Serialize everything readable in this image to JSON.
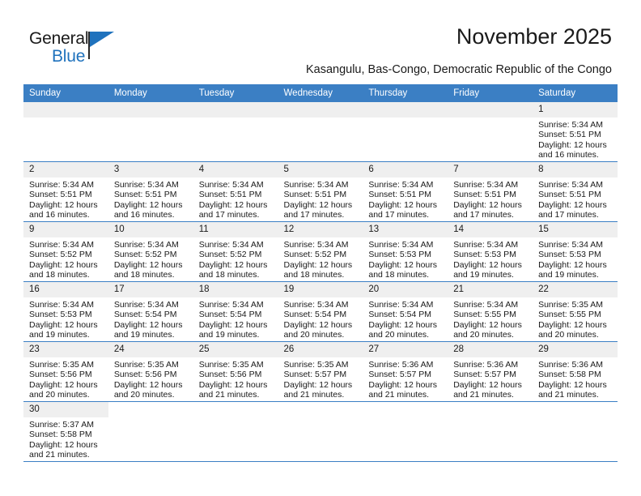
{
  "brand": {
    "name_top": "General",
    "name_bottom": "Blue",
    "flag_icon": "blue-triangle-flag",
    "accent_color": "#1f72bd"
  },
  "header": {
    "title": "November 2025",
    "subtitle": "Kasangulu, Bas-Congo, Democratic Republic of the Congo"
  },
  "calendar": {
    "header_bg": "#3b7fc4",
    "daynum_bg": "#efefef",
    "weekday_headers": [
      "Sunday",
      "Monday",
      "Tuesday",
      "Wednesday",
      "Thursday",
      "Friday",
      "Saturday"
    ],
    "weeks": [
      [
        {
          "day": "",
          "lines": []
        },
        {
          "day": "",
          "lines": []
        },
        {
          "day": "",
          "lines": []
        },
        {
          "day": "",
          "lines": []
        },
        {
          "day": "",
          "lines": []
        },
        {
          "day": "",
          "lines": []
        },
        {
          "day": "1",
          "lines": [
            "Sunrise: 5:34 AM",
            "Sunset: 5:51 PM",
            "Daylight: 12 hours",
            "and 16 minutes."
          ]
        }
      ],
      [
        {
          "day": "2",
          "lines": [
            "Sunrise: 5:34 AM",
            "Sunset: 5:51 PM",
            "Daylight: 12 hours",
            "and 16 minutes."
          ]
        },
        {
          "day": "3",
          "lines": [
            "Sunrise: 5:34 AM",
            "Sunset: 5:51 PM",
            "Daylight: 12 hours",
            "and 16 minutes."
          ]
        },
        {
          "day": "4",
          "lines": [
            "Sunrise: 5:34 AM",
            "Sunset: 5:51 PM",
            "Daylight: 12 hours",
            "and 17 minutes."
          ]
        },
        {
          "day": "5",
          "lines": [
            "Sunrise: 5:34 AM",
            "Sunset: 5:51 PM",
            "Daylight: 12 hours",
            "and 17 minutes."
          ]
        },
        {
          "day": "6",
          "lines": [
            "Sunrise: 5:34 AM",
            "Sunset: 5:51 PM",
            "Daylight: 12 hours",
            "and 17 minutes."
          ]
        },
        {
          "day": "7",
          "lines": [
            "Sunrise: 5:34 AM",
            "Sunset: 5:51 PM",
            "Daylight: 12 hours",
            "and 17 minutes."
          ]
        },
        {
          "day": "8",
          "lines": [
            "Sunrise: 5:34 AM",
            "Sunset: 5:51 PM",
            "Daylight: 12 hours",
            "and 17 minutes."
          ]
        }
      ],
      [
        {
          "day": "9",
          "lines": [
            "Sunrise: 5:34 AM",
            "Sunset: 5:52 PM",
            "Daylight: 12 hours",
            "and 18 minutes."
          ]
        },
        {
          "day": "10",
          "lines": [
            "Sunrise: 5:34 AM",
            "Sunset: 5:52 PM",
            "Daylight: 12 hours",
            "and 18 minutes."
          ]
        },
        {
          "day": "11",
          "lines": [
            "Sunrise: 5:34 AM",
            "Sunset: 5:52 PM",
            "Daylight: 12 hours",
            "and 18 minutes."
          ]
        },
        {
          "day": "12",
          "lines": [
            "Sunrise: 5:34 AM",
            "Sunset: 5:52 PM",
            "Daylight: 12 hours",
            "and 18 minutes."
          ]
        },
        {
          "day": "13",
          "lines": [
            "Sunrise: 5:34 AM",
            "Sunset: 5:53 PM",
            "Daylight: 12 hours",
            "and 18 minutes."
          ]
        },
        {
          "day": "14",
          "lines": [
            "Sunrise: 5:34 AM",
            "Sunset: 5:53 PM",
            "Daylight: 12 hours",
            "and 19 minutes."
          ]
        },
        {
          "day": "15",
          "lines": [
            "Sunrise: 5:34 AM",
            "Sunset: 5:53 PM",
            "Daylight: 12 hours",
            "and 19 minutes."
          ]
        }
      ],
      [
        {
          "day": "16",
          "lines": [
            "Sunrise: 5:34 AM",
            "Sunset: 5:53 PM",
            "Daylight: 12 hours",
            "and 19 minutes."
          ]
        },
        {
          "day": "17",
          "lines": [
            "Sunrise: 5:34 AM",
            "Sunset: 5:54 PM",
            "Daylight: 12 hours",
            "and 19 minutes."
          ]
        },
        {
          "day": "18",
          "lines": [
            "Sunrise: 5:34 AM",
            "Sunset: 5:54 PM",
            "Daylight: 12 hours",
            "and 19 minutes."
          ]
        },
        {
          "day": "19",
          "lines": [
            "Sunrise: 5:34 AM",
            "Sunset: 5:54 PM",
            "Daylight: 12 hours",
            "and 20 minutes."
          ]
        },
        {
          "day": "20",
          "lines": [
            "Sunrise: 5:34 AM",
            "Sunset: 5:54 PM",
            "Daylight: 12 hours",
            "and 20 minutes."
          ]
        },
        {
          "day": "21",
          "lines": [
            "Sunrise: 5:34 AM",
            "Sunset: 5:55 PM",
            "Daylight: 12 hours",
            "and 20 minutes."
          ]
        },
        {
          "day": "22",
          "lines": [
            "Sunrise: 5:35 AM",
            "Sunset: 5:55 PM",
            "Daylight: 12 hours",
            "and 20 minutes."
          ]
        }
      ],
      [
        {
          "day": "23",
          "lines": [
            "Sunrise: 5:35 AM",
            "Sunset: 5:56 PM",
            "Daylight: 12 hours",
            "and 20 minutes."
          ]
        },
        {
          "day": "24",
          "lines": [
            "Sunrise: 5:35 AM",
            "Sunset: 5:56 PM",
            "Daylight: 12 hours",
            "and 20 minutes."
          ]
        },
        {
          "day": "25",
          "lines": [
            "Sunrise: 5:35 AM",
            "Sunset: 5:56 PM",
            "Daylight: 12 hours",
            "and 21 minutes."
          ]
        },
        {
          "day": "26",
          "lines": [
            "Sunrise: 5:35 AM",
            "Sunset: 5:57 PM",
            "Daylight: 12 hours",
            "and 21 minutes."
          ]
        },
        {
          "day": "27",
          "lines": [
            "Sunrise: 5:36 AM",
            "Sunset: 5:57 PM",
            "Daylight: 12 hours",
            "and 21 minutes."
          ]
        },
        {
          "day": "28",
          "lines": [
            "Sunrise: 5:36 AM",
            "Sunset: 5:57 PM",
            "Daylight: 12 hours",
            "and 21 minutes."
          ]
        },
        {
          "day": "29",
          "lines": [
            "Sunrise: 5:36 AM",
            "Sunset: 5:58 PM",
            "Daylight: 12 hours",
            "and 21 minutes."
          ]
        }
      ],
      [
        {
          "day": "30",
          "lines": [
            "Sunrise: 5:37 AM",
            "Sunset: 5:58 PM",
            "Daylight: 12 hours",
            "and 21 minutes."
          ]
        },
        {
          "day": "",
          "lines": []
        },
        {
          "day": "",
          "lines": []
        },
        {
          "day": "",
          "lines": []
        },
        {
          "day": "",
          "lines": []
        },
        {
          "day": "",
          "lines": []
        },
        {
          "day": "",
          "lines": []
        }
      ]
    ]
  }
}
